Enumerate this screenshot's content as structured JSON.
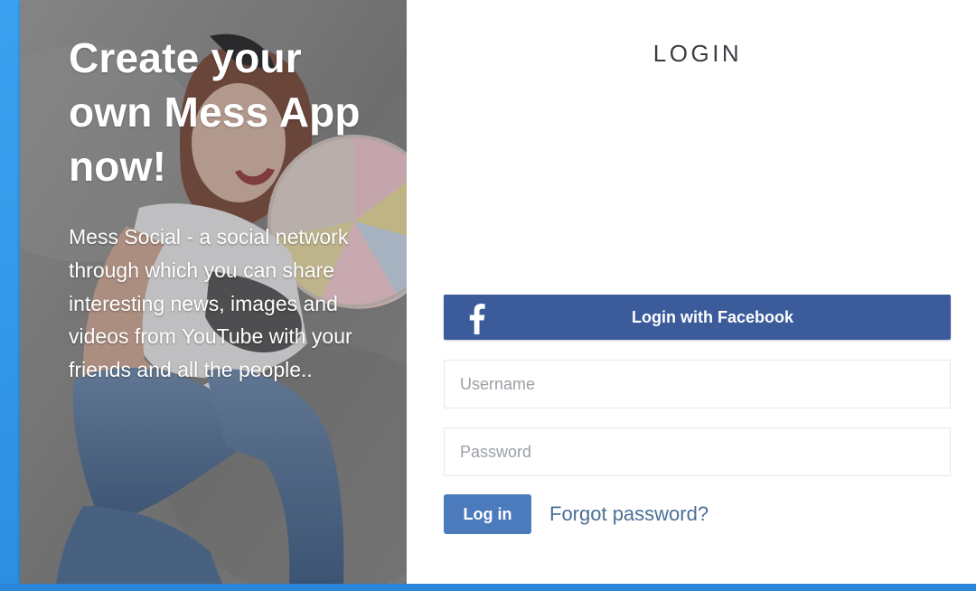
{
  "hero": {
    "title": "Create your own Mess App now!",
    "description": "Mess Social - a social network through which you can share interesting news, images and videos from YouTube with your friends and all the people..",
    "image": "woman-with-giant-lollipop-photo"
  },
  "login": {
    "title": "LOGIN",
    "facebook_button": {
      "label": "Login with Facebook",
      "icon": "facebook-icon",
      "color": "#3b5b9b"
    },
    "username": {
      "placeholder": "Username",
      "value": ""
    },
    "password": {
      "placeholder": "Password",
      "value": ""
    },
    "submit_label": "Log in",
    "forgot_label": "Forgot password?"
  },
  "colors": {
    "accent": "#4c7bbd",
    "link": "#4b6f95",
    "page_background": "#2f8fdc"
  }
}
